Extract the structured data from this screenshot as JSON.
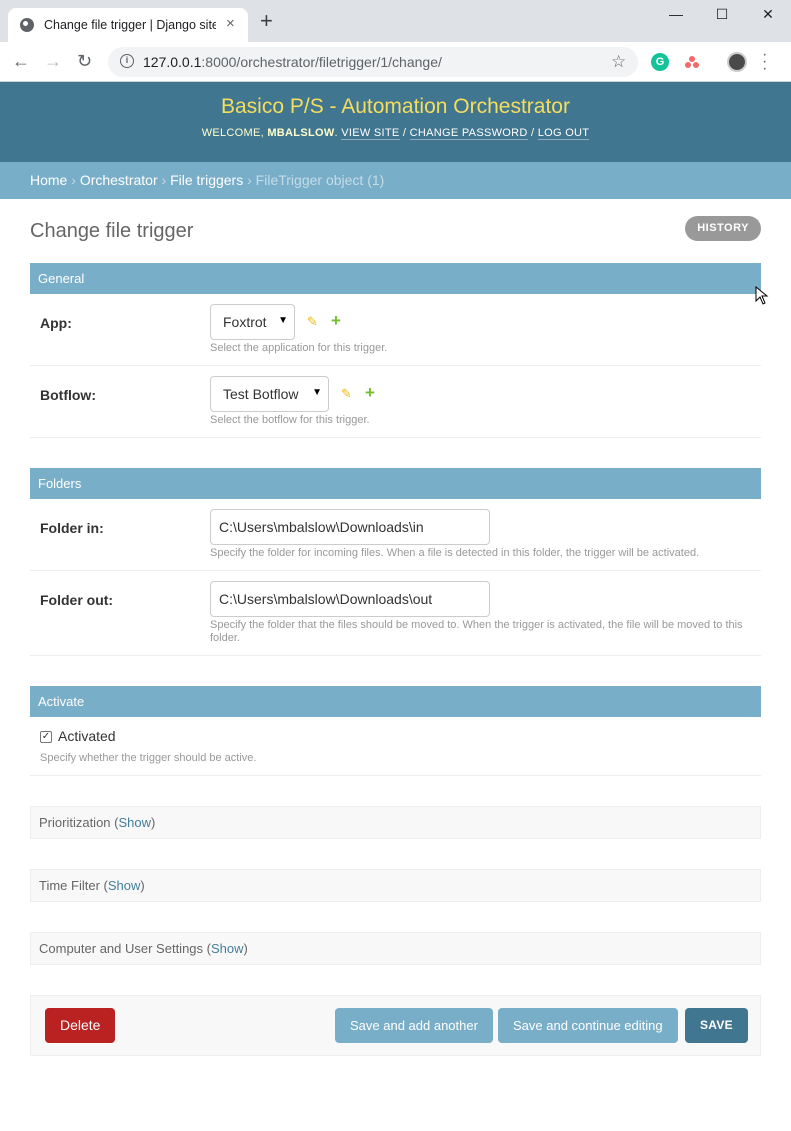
{
  "browser": {
    "tab_title": "Change file trigger | Django site admin",
    "tab_close": "×",
    "new_tab": "+",
    "minimize": "—",
    "maximize": "☐",
    "close": "✕",
    "url_host": "127.0.0.1",
    "url_rest": ":8000/orchestrator/filetrigger/1/change/",
    "grammarly": "G"
  },
  "header": {
    "site_title": "Basico P/S - Automation Orchestrator",
    "welcome": "Welcome,",
    "username": "mbalslow",
    "view_site": "View site",
    "change_password": "Change password",
    "log_out": "Log out"
  },
  "breadcrumbs": {
    "home": "Home",
    "app": "Orchestrator",
    "model": "File triggers",
    "current": "FileTrigger object (1)"
  },
  "page": {
    "title": "Change file trigger",
    "history": "History"
  },
  "general": {
    "header": "General",
    "app_label": "App:",
    "app_value": "Foxtrot",
    "app_help": "Select the application for this trigger.",
    "botflow_label": "Botflow:",
    "botflow_value": "Test Botflow",
    "botflow_help": "Select the botflow for this trigger."
  },
  "folders": {
    "header": "Folders",
    "folder_in_label": "Folder in:",
    "folder_in_value": "C:\\Users\\mbalslow\\Downloads\\in",
    "folder_in_help": "Specify the folder for incoming files. When a file is detected in this folder, the trigger will be activated.",
    "folder_out_label": "Folder out:",
    "folder_out_value": "C:\\Users\\mbalslow\\Downloads\\out",
    "folder_out_help": "Specify the folder that the files should be moved to. When the trigger is activated, the file will be moved to this folder."
  },
  "activate": {
    "header": "Activate",
    "checkbox_label": "Activated",
    "checked": true,
    "help": "Specify whether the trigger should be active."
  },
  "collapsed": [
    {
      "label": "Prioritization",
      "show": "Show"
    },
    {
      "label": "Time Filter",
      "show": "Show"
    },
    {
      "label": "Computer and User Settings",
      "show": "Show"
    }
  ],
  "submit": {
    "delete": "Delete",
    "save_add": "Save and add another",
    "save_continue": "Save and continue editing",
    "save": "SAVE"
  },
  "colors": {
    "header_bg": "#417690",
    "breadcrumb_bg": "#79aec8",
    "title_yellow": "#f5dd5d",
    "delete_red": "#ba2121"
  }
}
